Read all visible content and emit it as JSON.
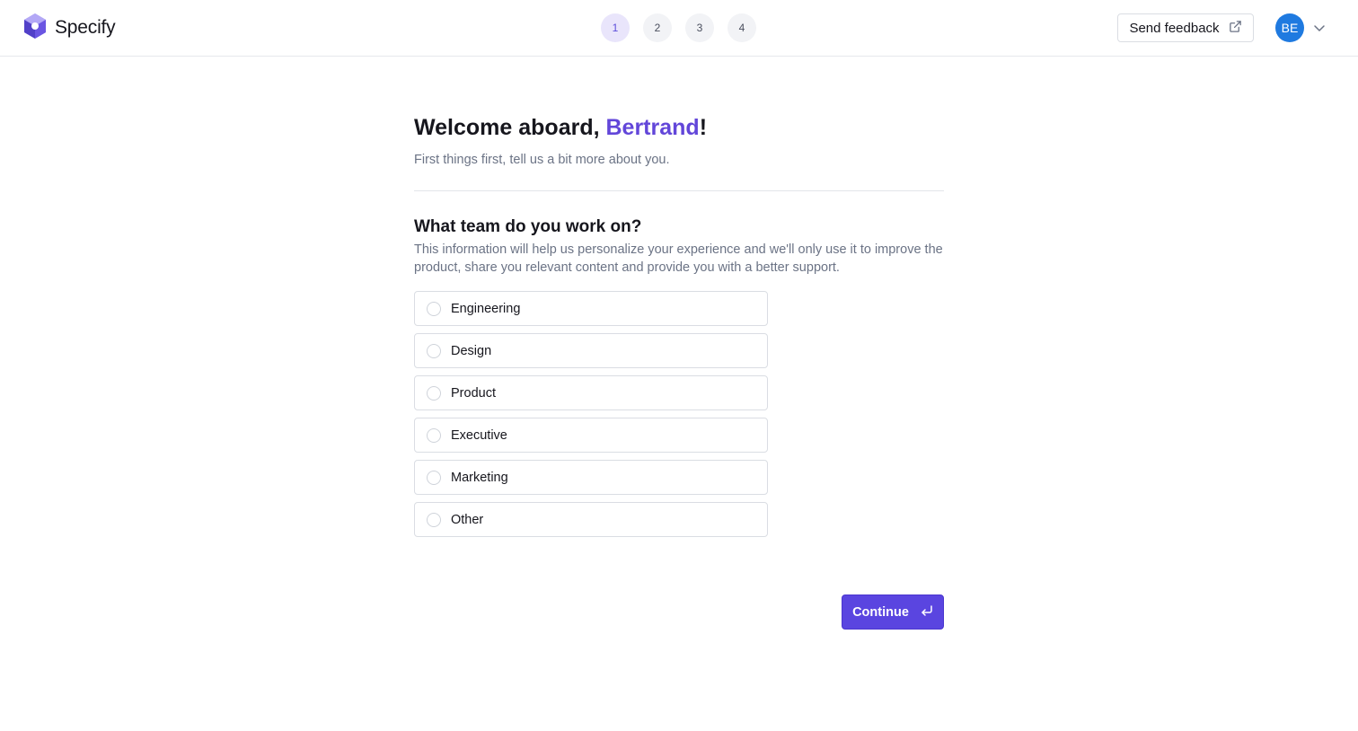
{
  "header": {
    "brand_name": "Specify",
    "steps": [
      "1",
      "2",
      "3",
      "4"
    ],
    "active_step": 1,
    "feedback_label": "Send feedback",
    "avatar_initials": "BE"
  },
  "main": {
    "welcome_prefix": "Welcome aboard, ",
    "user_name": "Bertrand",
    "welcome_suffix": "!",
    "subtitle": "First things first, tell us a bit more about you.",
    "question": "What team do you work on?",
    "help_text": "This information will help us personalize your experience and we'll only use it to improve the product, share you relevant content and provide you with a better support.",
    "options": [
      "Engineering",
      "Design",
      "Product",
      "Executive",
      "Marketing",
      "Other"
    ],
    "continue_label": "Continue"
  },
  "colors": {
    "accent": "#5a45e0",
    "avatar": "#1f7ae0",
    "name_highlight": "#6246d9"
  },
  "icons": {
    "brand": "specify-logo-icon",
    "feedback": "external-link-icon",
    "avatar_menu": "chevron-down-icon",
    "continue": "enter-return-icon"
  }
}
